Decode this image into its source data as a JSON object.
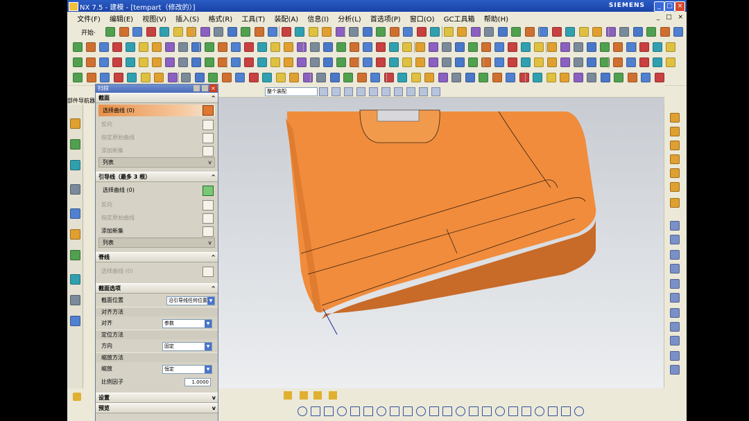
{
  "window": {
    "title": "NX 7.5 - 建模 - [tempart（修改的）]",
    "brand": "SIEMENS",
    "buttons": {
      "minimize": "_",
      "maximize": "□",
      "close": "×"
    }
  },
  "menubar": {
    "items": [
      "文件(F)",
      "编辑(E)",
      "视图(V)",
      "插入(S)",
      "格式(R)",
      "工具(T)",
      "装配(A)",
      "信息(I)",
      "分析(L)",
      "首选项(P)",
      "窗口(O)",
      "GC工具箱",
      "帮助(H)"
    ],
    "mdi_controls": "_ □ ×"
  },
  "toolbar": {
    "start_label": "开始·",
    "selection_filter": "整个装配"
  },
  "dialog": {
    "title": "扫掠",
    "close": "×",
    "sections": {
      "section": "截面",
      "guide": "引导线（最多 3 根）",
      "spine": "脊线",
      "options": "截面选项"
    },
    "section_rows": {
      "select_curve": "选择曲线 (0)",
      "specify_origin": "指定原始曲线",
      "add_new_set": "添加新集",
      "list": "列表"
    },
    "guide_rows": {
      "select_curve": "选择曲线 (0)",
      "specify_origin": "指定原始曲线",
      "add_new_set": "添加新集",
      "list": "列表"
    },
    "spine_rows": {
      "select_curve": "选择曲线 (0)"
    },
    "options_rows": {
      "section_location": "截面位置",
      "section_location_value": "沿引导线任何位置",
      "alignment_method": "对齐方法",
      "alignment_label": "对齐",
      "alignment_value": "参数",
      "orientation_method": "定位方法",
      "orientation_label": "方向",
      "orientation_value": "固定",
      "scaling_method": "缩放方法",
      "scaling_label": "缩放",
      "scaling_value": "恒定",
      "scale_factor_label": "比例因子",
      "scale_factor_value": "1.0000"
    },
    "bottom_sections": {
      "settings": "设置",
      "preview": "预览"
    },
    "chevron_up": "^",
    "chevron_down": "v"
  },
  "resource_bar": {
    "nav_title": "部件导航器"
  },
  "colors": {
    "model_face": "#f08c3c",
    "model_shadow": "#c86a28",
    "active_row": "#e8904a",
    "title_blue": "#1a43a8"
  }
}
